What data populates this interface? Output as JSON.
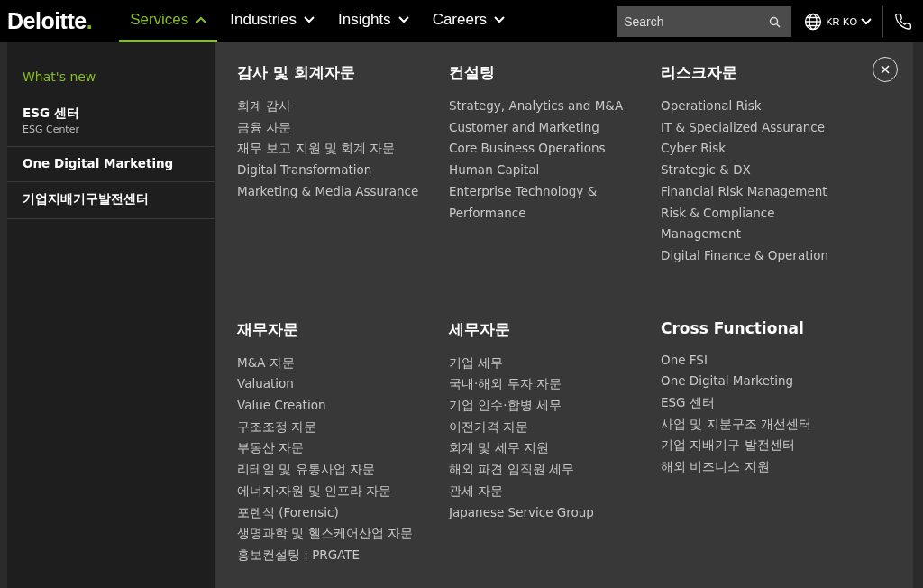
{
  "header": {
    "logo": "Deloitte",
    "logo_dot": ".",
    "nav": [
      {
        "label": "Services",
        "selected": true
      },
      {
        "label": "Industries",
        "selected": false
      },
      {
        "label": "Insights",
        "selected": false
      },
      {
        "label": "Careers",
        "selected": false
      }
    ],
    "search": {
      "placeholder": "Search"
    },
    "language": "KR-KO"
  },
  "sidebar": {
    "heading": "What's new",
    "items": [
      {
        "title": "ESG 센터",
        "subtitle": "ESG Center"
      },
      {
        "title": "One Digital Marketing"
      },
      {
        "title": "기업지배기구발전센터"
      }
    ]
  },
  "sections": [
    {
      "title": "감사 및 회계자문",
      "links": [
        "회계 감사",
        "금융 자문",
        "재무 보고 지원 및 회계 자문",
        "Digital Transformation",
        "Marketing & Media Assurance"
      ]
    },
    {
      "title": "컨설팅",
      "links": [
        "Strategy, Analytics and M&A",
        "Customer and Marketing",
        "Core Business Operations",
        "Human Capital",
        "Enterprise Technology & Performance"
      ]
    },
    {
      "title": "리스크자문",
      "links": [
        "Operational Risk",
        "IT & Specialized Assurance",
        "Cyber Risk",
        "Strategic & DX",
        "Financial Risk Management",
        "Risk & Compliance Management",
        "Digital Finance & Operation"
      ]
    },
    {
      "title": "재무자문",
      "links": [
        "M&A 자문",
        "Valuation",
        "Value Creation",
        "구조조정 자문",
        "부동산 자문",
        "리테일 및 유통사업 자문",
        "에너지·자원 및 인프라 자문",
        "포렌식 (Forensic)",
        "생명과학 및 헬스케어산업 자문",
        "홍보컨설팅 : PRGATE"
      ]
    },
    {
      "title": "세무자문",
      "links": [
        "기업 세무",
        "국내·해외 투자 자문",
        "기업 인수·합병 세무",
        "이전가격 자문",
        "회계 및 세무 지원",
        "해외 파견 임직원 세무",
        "관세 자문",
        "Japanese Service Group"
      ]
    },
    {
      "title": "Cross Functional",
      "links": [
        "One FSI",
        "One Digital Marketing",
        "ESG 센터",
        "사업 및 지분구조 개선센터",
        "기업 지배기구 발전센터",
        "해외 비즈니스 지원"
      ]
    }
  ]
}
